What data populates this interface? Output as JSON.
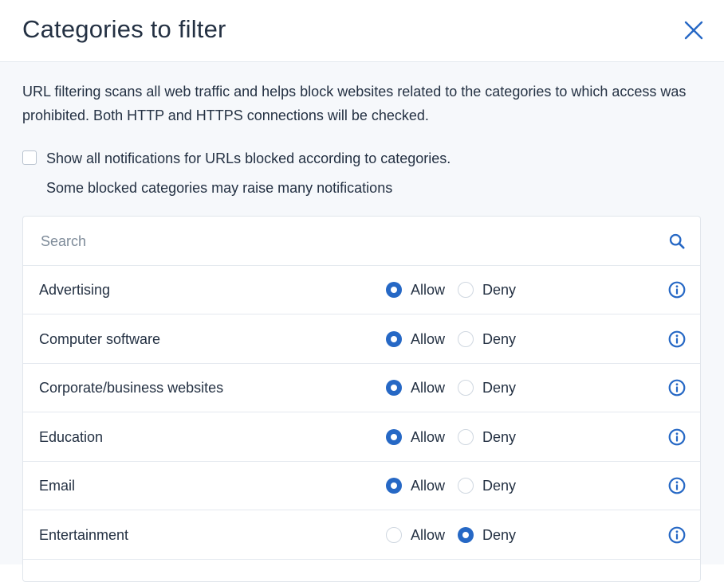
{
  "dialog": {
    "title": "Categories to filter",
    "description": "URL filtering scans all web traffic and helps block websites related to the categories to which access was prohibited. Both HTTP and HTTPS connections will be checked.",
    "notifications_label": "Show all notifications for URLs blocked according to categories.",
    "notifications_checked": false,
    "notifications_hint": "Some blocked categories may raise many notifications"
  },
  "search": {
    "placeholder": "Search",
    "value": ""
  },
  "options": {
    "allow_label": "Allow",
    "deny_label": "Deny"
  },
  "categories": [
    {
      "name": "Advertising",
      "selected": "allow"
    },
    {
      "name": "Computer software",
      "selected": "allow"
    },
    {
      "name": "Corporate/business websites",
      "selected": "allow"
    },
    {
      "name": "Education",
      "selected": "allow"
    },
    {
      "name": "Email",
      "selected": "allow"
    },
    {
      "name": "Entertainment",
      "selected": "deny"
    }
  ],
  "icons": {
    "close": "close-icon",
    "search": "search-icon",
    "info": "info-icon"
  },
  "colors": {
    "accent": "#2668c5",
    "text": "#243143",
    "body_background": "#f6f8fb"
  }
}
